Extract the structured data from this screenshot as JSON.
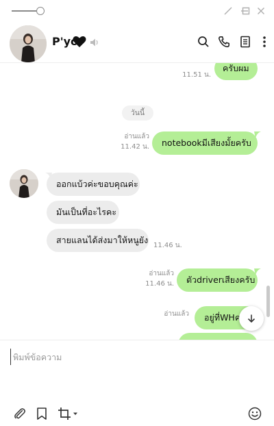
{
  "contact": {
    "name": "P'yo"
  },
  "header_icons": [
    "search-icon",
    "phone-icon",
    "notes-icon",
    "more-icon"
  ],
  "date_divider": "วันนี้",
  "messages": [
    {
      "side": "me",
      "text": "ครับผม",
      "time": "11.51 น.",
      "read": ""
    },
    {
      "side": "me",
      "text": "notebookมีเสียงมั้ยครับ",
      "time": "11.42 น.",
      "read": "อ่านแล้ว"
    },
    {
      "side": "them",
      "text": "ออกแบ้วค่ะขอบคุณค่ะ",
      "time": "",
      "read": ""
    },
    {
      "side": "them",
      "text": "มันเป็นที่อะไรคะ",
      "time": "",
      "read": ""
    },
    {
      "side": "them",
      "text": "สายแลนได้ส่งมาให้หนูยัง",
      "time": "11.46 น.",
      "read": ""
    },
    {
      "side": "me",
      "text": "ตัวdriverเสียงครับ",
      "time": "11.46 น.",
      "read": "อ่านแล้ว"
    },
    {
      "side": "me",
      "text": "อยู่ที่WHค",
      "time": "",
      "read": "อ่านแล้ว"
    }
  ],
  "composer": {
    "placeholder": "พิมพ์ข้อความ",
    "value": ""
  },
  "colors": {
    "my_bubble": "#b4ee96",
    "their_bubble": "#ececec",
    "meta_text": "#8c8c8c"
  }
}
